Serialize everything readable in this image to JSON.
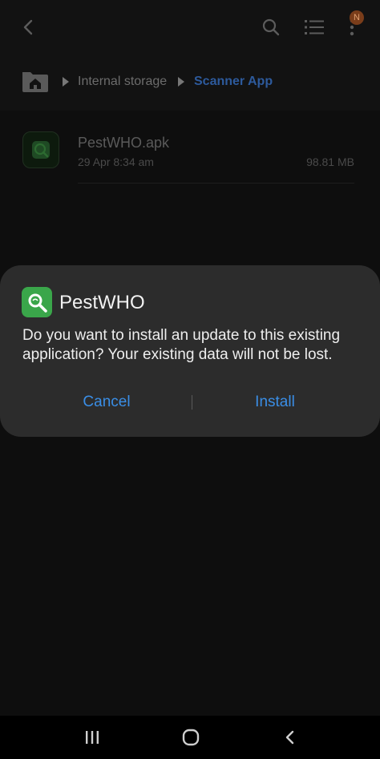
{
  "topbar": {
    "back_icon": "chevron-left-icon",
    "search_icon": "search-icon",
    "list_icon": "list-view-icon",
    "more_icon": "more-vert-icon",
    "badge_text": "N"
  },
  "breadcrumb": {
    "home_icon": "home-folder-icon",
    "items": [
      "Internal storage",
      "Scanner App"
    ]
  },
  "files": [
    {
      "name": "PestWHO.apk",
      "date": "29 Apr 8:34 am",
      "size": "98.81 MB"
    }
  ],
  "dialog": {
    "app_name": "PestWHO",
    "message": "Do you want to install an update to this existing application? Your existing data will not be lost.",
    "cancel_label": "Cancel",
    "install_label": "Install"
  },
  "navbar": {
    "recents_icon": "recents-icon",
    "home_icon": "home-circle-icon",
    "back_icon": "back-chevron-icon"
  },
  "colors": {
    "accent": "#3a8ee6",
    "app_icon_green": "#3aa64a",
    "dialog_bg": "#2c2c2c"
  }
}
